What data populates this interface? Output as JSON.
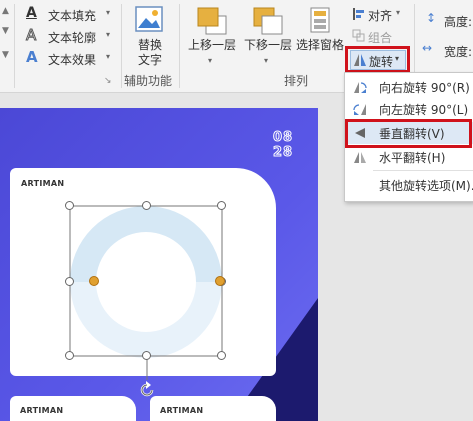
{
  "ribbon": {
    "text_fill": "文本填充",
    "text_outline": "文本轮廓",
    "text_effect": "文本效果",
    "alt_text": [
      "替换",
      "文字"
    ],
    "group_accessibility": "辅助功能",
    "bring_forward": "上移一层",
    "send_backward": "下移一层",
    "selection_pane": "选择窗格",
    "group_arrange": "排列",
    "align": "对齐",
    "group": "组合",
    "rotate": "旋转",
    "height": "高度:",
    "width": "宽度:"
  },
  "rotate_menu": {
    "items": [
      {
        "label": "向右旋转 90°(R)",
        "icon": "rotate-right-icon"
      },
      {
        "label": "向左旋转 90°(L)",
        "icon": "rotate-left-icon"
      },
      {
        "label": "垂直翻转(V)",
        "icon": "flip-vertical-icon"
      },
      {
        "label": "水平翻转(H)",
        "icon": "flip-horizontal-icon"
      },
      {
        "label": "其他旋转选项(M)..."
      }
    ],
    "highlighted": "垂直翻转(V)"
  },
  "slide": {
    "date_top": "08",
    "date_bottom": "28",
    "brand_1": "ARTIMAN",
    "brand_2": "ARTIMAN",
    "brand_3": "ARTIMAN"
  },
  "colors": {
    "slide_bg": "#4b48d6",
    "highlight_box": "#d0121b",
    "shape_fill": "#d6e8f5",
    "menu_highlight": "#dde8f5"
  }
}
